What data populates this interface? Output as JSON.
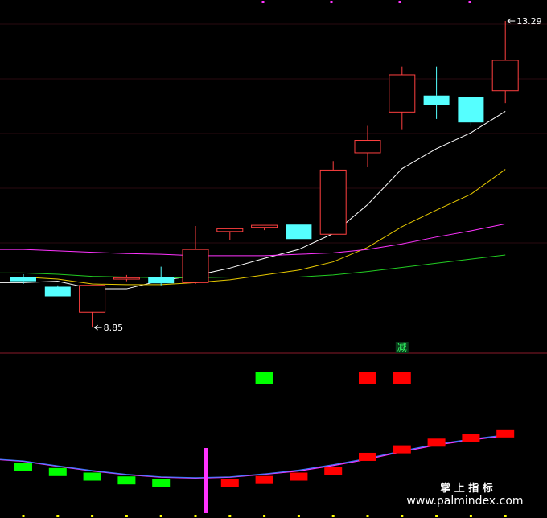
{
  "chart_data": [
    {
      "type": "candlestick",
      "panel": "price",
      "price_range": [
        8.7,
        13.5
      ],
      "up_color": "#ff4040",
      "down_color": "#55ffff",
      "candles": [
        {
          "o": 9.58,
          "h": 9.62,
          "l": 9.48,
          "c": 9.52
        },
        {
          "o": 9.44,
          "h": 9.46,
          "l": 9.3,
          "c": 9.3
        },
        {
          "o": 9.07,
          "h": 9.46,
          "l": 8.85,
          "c": 9.46
        },
        {
          "o": 9.55,
          "h": 9.61,
          "l": 9.52,
          "c": 9.57
        },
        {
          "o": 9.58,
          "h": 9.73,
          "l": 9.46,
          "c": 9.49
        },
        {
          "o": 9.5,
          "h": 10.32,
          "l": 9.48,
          "c": 9.98
        },
        {
          "o": 10.24,
          "h": 10.28,
          "l": 10.12,
          "c": 10.28
        },
        {
          "o": 10.3,
          "h": 10.33,
          "l": 10.26,
          "c": 10.33
        },
        {
          "o": 10.34,
          "h": 10.34,
          "l": 10.13,
          "c": 10.13
        },
        {
          "o": 10.2,
          "h": 11.26,
          "l": 10.2,
          "c": 11.13
        },
        {
          "o": 11.38,
          "h": 11.77,
          "l": 11.17,
          "c": 11.56
        },
        {
          "o": 11.97,
          "h": 12.63,
          "l": 11.71,
          "c": 12.51
        },
        {
          "o": 12.21,
          "h": 12.63,
          "l": 11.87,
          "c": 12.07
        },
        {
          "o": 12.19,
          "h": 12.19,
          "l": 11.77,
          "c": 11.82
        },
        {
          "o": 12.28,
          "h": 13.29,
          "l": 12.1,
          "c": 12.72
        }
      ],
      "ma_lines": [
        {
          "color": "#ffffff",
          "values": [
            9.5,
            9.52,
            9.41,
            9.41,
            9.53,
            9.6,
            9.71,
            9.85,
            9.98,
            10.21,
            10.63,
            11.15,
            11.44,
            11.67,
            11.98
          ]
        },
        {
          "color": "#e6c800",
          "values": [
            9.58,
            9.55,
            9.48,
            9.47,
            9.47,
            9.5,
            9.54,
            9.61,
            9.68,
            9.8,
            10.01,
            10.31,
            10.55,
            10.78,
            11.14
          ]
        },
        {
          "color": "#ff33ff",
          "values": [
            9.98,
            9.96,
            9.94,
            9.92,
            9.91,
            9.89,
            9.89,
            9.89,
            9.91,
            9.93,
            9.98,
            10.06,
            10.16,
            10.25,
            10.35
          ]
        },
        {
          "color": "#22cc22",
          "values": [
            9.64,
            9.62,
            9.59,
            9.58,
            9.57,
            9.57,
            9.58,
            9.58,
            9.58,
            9.61,
            9.66,
            9.72,
            9.78,
            9.84,
            9.9
          ]
        }
      ],
      "annotations": [
        {
          "text": "13.29",
          "candle_index": 14,
          "at": "high"
        },
        {
          "text": "8.85",
          "candle_index": 2,
          "at": "low"
        }
      ]
    },
    {
      "type": "bar",
      "panel": "indicator",
      "values": [
        -2.1,
        -3.1,
        -3.9,
        -4.4,
        -4.8,
        -4.5,
        -3.7,
        -2.6,
        -1.8,
        -0.2,
        2.0,
        4.0,
        5.6,
        6.8,
        7.9
      ],
      "colors": [
        "green",
        "green",
        "green",
        "green",
        "green",
        "none",
        "red",
        "red",
        "red",
        "red",
        "red",
        "red",
        "red",
        "red",
        "red"
      ],
      "lines": [
        {
          "color": "#ff33ff",
          "values": [
            -0.3,
            -1.5,
            -2.6,
            -3.5,
            -4.1,
            -4.3,
            -4.1,
            -3.4,
            -2.6,
            -1.3,
            0.2,
            2.0,
            3.6,
            4.8,
            5.8
          ]
        },
        {
          "color": "#4477ff",
          "values": [
            -0.2,
            -1.4,
            -2.5,
            -3.4,
            -4.0,
            -4.2,
            -4.0,
            -3.3,
            -2.4,
            -1.1,
            0.4,
            2.2,
            3.8,
            5.0,
            6.0
          ]
        }
      ],
      "floating_markers": [
        {
          "candle_index": 7,
          "color": "green"
        },
        {
          "candle_index": 10,
          "color": "red"
        },
        {
          "candle_index": 11,
          "color": "red"
        }
      ],
      "signal_text": "减",
      "signal_candle_index": 11,
      "vertical_marker_index": 5
    }
  ],
  "watermark": {
    "cn": "掌 上 指 标",
    "url": "www.palmindex.com"
  },
  "colors": {
    "background": "#000000",
    "separator": "#8a1a2a",
    "up": "#ff4040",
    "down": "#55ffff",
    "ind_green": "#00ff00",
    "ind_red": "#ff0000",
    "marker": "#ff33ff"
  }
}
